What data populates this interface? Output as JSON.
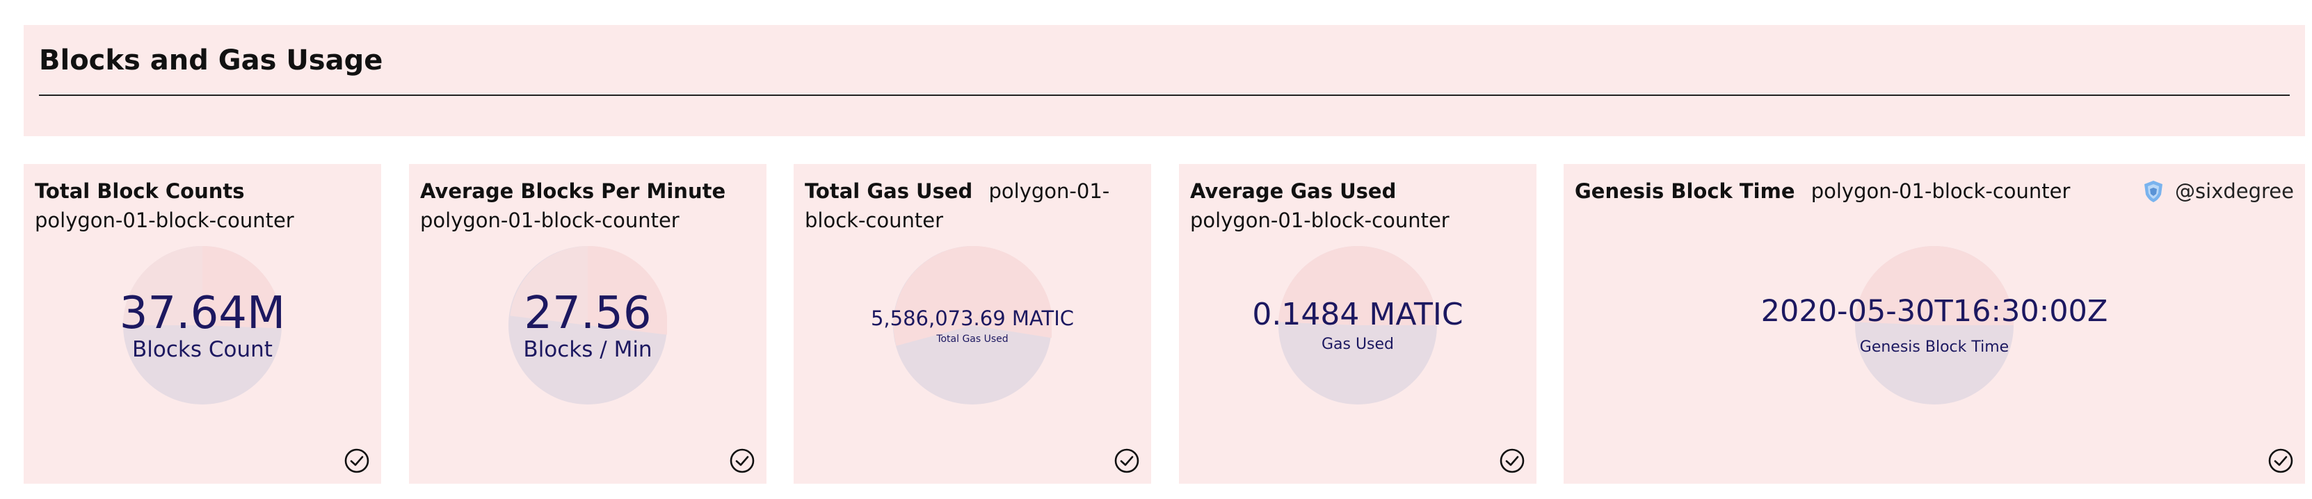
{
  "section": {
    "title": "Blocks and Gas Usage"
  },
  "cards": [
    {
      "title": "Total Block Counts",
      "source": "polygon-01-block-counter",
      "value": "37.64M",
      "caption": "Blocks Count"
    },
    {
      "title": "Average Blocks Per Minute",
      "source": "polygon-01-block-counter",
      "value": "27.56",
      "caption": "Blocks / Min"
    },
    {
      "title": "Total Gas Used",
      "source": "polygon-01-block-counter",
      "value": "5,586,073.69 MATIC",
      "caption": "Total Gas Used"
    },
    {
      "title": "Average Gas Used",
      "source": "polygon-01-block-counter",
      "value": "0.1484 MATIC",
      "caption": "Gas Used"
    },
    {
      "title": "Genesis Block Time",
      "source": "polygon-01-block-counter",
      "value": "2020-05-30T16:30:00Z",
      "caption": "Genesis Block Time"
    }
  ],
  "badge": {
    "handle": "@sixdegree",
    "icon": "shield-logo-icon"
  },
  "colors": {
    "panel_bg": "#fceaea",
    "pie_light": "#f8dcdc",
    "pie_dark": "#e6dbe3",
    "value_text": "#1c1860"
  },
  "icons": {
    "status": "check-circle-icon"
  }
}
